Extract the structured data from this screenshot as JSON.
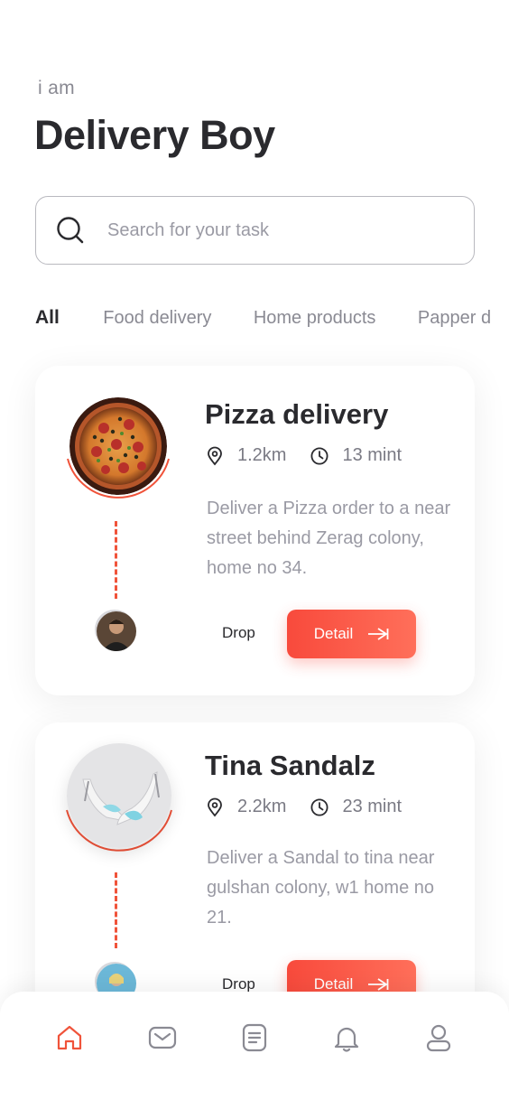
{
  "header": {
    "greeting": "i am",
    "title": "Delivery Boy"
  },
  "search": {
    "placeholder": "Search for your task"
  },
  "tabs": [
    {
      "label": "All",
      "active": true
    },
    {
      "label": "Food delivery",
      "active": false
    },
    {
      "label": "Home products",
      "active": false
    },
    {
      "label": "Papper d",
      "active": false
    }
  ],
  "tasks": [
    {
      "title": "Pizza delivery",
      "distance": "1.2km",
      "time": "13 mint",
      "description": "Deliver a Pizza order to a near street behind Zerag colony, home no 34.",
      "drop_label": "Drop",
      "detail_label": "Detail",
      "thumbnail": "pizza-image"
    },
    {
      "title": "Tina Sandalz",
      "distance": "2.2km",
      "time": "23 mint",
      "description": "Deliver a Sandal to tina near gulshan colony, w1 home no 21.",
      "drop_label": "Drop",
      "detail_label": "Detail",
      "thumbnail": "sandals-image"
    }
  ],
  "bottom_nav": [
    {
      "icon": "home-icon",
      "active": true
    },
    {
      "icon": "mail-icon",
      "active": false
    },
    {
      "icon": "document-icon",
      "active": false
    },
    {
      "icon": "bell-icon",
      "active": false
    },
    {
      "icon": "profile-icon",
      "active": false
    }
  ],
  "colors": {
    "accent": "#f84a3c",
    "text_dark": "#2a2a2e",
    "text_muted": "#9a9aa4"
  }
}
